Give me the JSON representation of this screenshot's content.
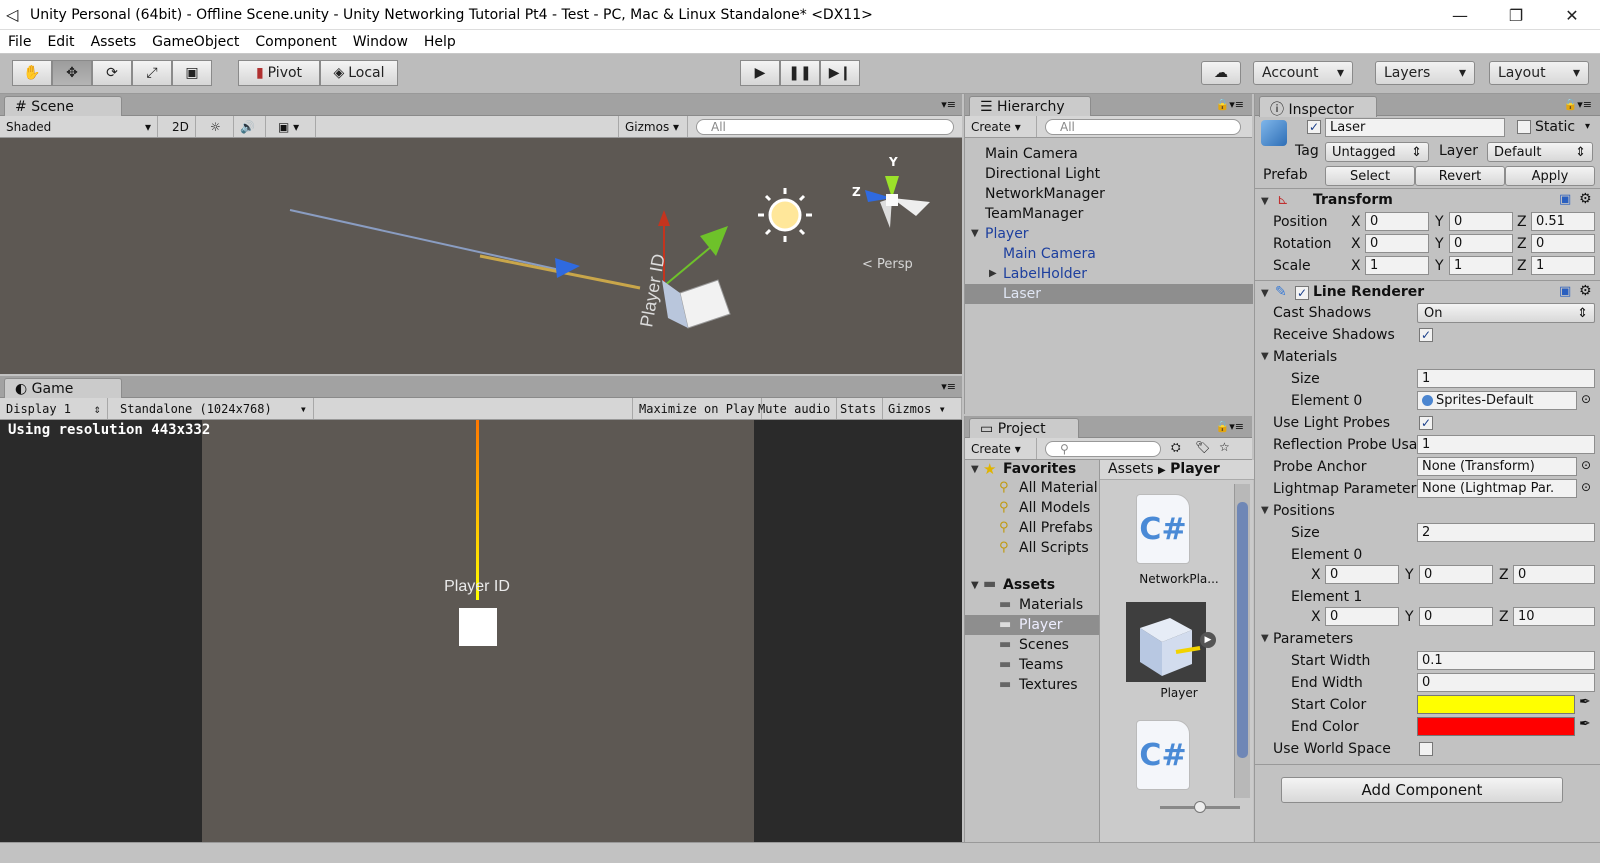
{
  "window": {
    "title": "Unity Personal (64bit) - Offline Scene.unity - Unity Networking Tutorial Pt4 - Test - PC, Mac & Linux Standalone* <DX11>"
  },
  "menu": [
    "File",
    "Edit",
    "Assets",
    "GameObject",
    "Component",
    "Window",
    "Help"
  ],
  "toolbar": {
    "pivot": "Pivot",
    "local": "Local",
    "account": "Account",
    "layers": "Layers",
    "layout": "Layout"
  },
  "scene": {
    "tab": "Scene",
    "shading": "Shaded",
    "mode2d": "2D",
    "gizmos": "Gizmos",
    "search_placeholder": "All",
    "persp": "< Persp",
    "player_label": "Player ID"
  },
  "game": {
    "tab": "Game",
    "display": "Display 1",
    "resolution": "Standalone (1024x768)",
    "maximize": "Maximize on Play",
    "mute": "Mute audio",
    "stats": "Stats",
    "gizmos": "Gizmos",
    "using_resolution": "Using resolution 443x332",
    "player_label": "Player ID"
  },
  "hierarchy": {
    "tab": "Hierarchy",
    "create": "Create",
    "search_placeholder": "All",
    "items": [
      "Main Camera",
      "Directional Light",
      "NetworkManager",
      "TeamManager",
      "Player",
      "Main Camera",
      "LabelHolder",
      "Laser"
    ]
  },
  "project": {
    "tab": "Project",
    "create": "Create",
    "favorites": "Favorites",
    "fav_items": [
      "All Material",
      "All Models",
      "All Prefabs",
      "All Scripts"
    ],
    "assets": "Assets",
    "asset_folders": [
      "Materials",
      "Player",
      "Scenes",
      "Teams",
      "Textures"
    ],
    "breadcrumb_root": "Assets",
    "breadcrumb_current": "Player",
    "files": [
      "NetworkPla...",
      "Player"
    ]
  },
  "inspector": {
    "tab": "Inspector",
    "object_name": "Laser",
    "static": "Static",
    "tag_label": "Tag",
    "tag_value": "Untagged",
    "layer_label": "Layer",
    "layer_value": "Default",
    "prefab_label": "Prefab",
    "select": "Select",
    "revert": "Revert",
    "apply": "Apply",
    "transform": {
      "title": "Transform",
      "position_label": "Position",
      "rotation_label": "Rotation",
      "scale_label": "Scale",
      "position": {
        "x": "0",
        "y": "0",
        "z": "0.51"
      },
      "rotation": {
        "x": "0",
        "y": "0",
        "z": "0"
      },
      "scale": {
        "x": "1",
        "y": "1",
        "z": "1"
      }
    },
    "line_renderer": {
      "title": "Line Renderer",
      "cast_shadows_label": "Cast Shadows",
      "cast_shadows": "On",
      "receive_shadows_label": "Receive Shadows",
      "materials_label": "Materials",
      "size_label": "Size",
      "materials_size": "1",
      "element0_label": "Element 0",
      "element0_value": "Sprites-Default",
      "use_light_probes_label": "Use Light Probes",
      "reflection_probe_label": "Reflection Probe Usa",
      "reflection_probe_value": "1",
      "probe_anchor_label": "Probe Anchor",
      "probe_anchor_value": "None (Transform)",
      "lightmap_label": "Lightmap Parameter",
      "lightmap_value": "None (Lightmap Par.",
      "positions_label": "Positions",
      "positions_size": "2",
      "element1_label": "Element 1",
      "e0": {
        "x": "0",
        "y": "0",
        "z": "0"
      },
      "e1": {
        "x": "0",
        "y": "0",
        "z": "10"
      },
      "parameters_label": "Parameters",
      "start_width_label": "Start Width",
      "start_width": "0.1",
      "end_width_label": "End Width",
      "end_width": "0",
      "start_color_label": "Start Color",
      "start_color": "#ffff00",
      "end_color_label": "End Color",
      "end_color": "#ff0000",
      "use_world_space_label": "Use World Space"
    },
    "add_component": "Add Component"
  },
  "axis_labels": {
    "x": "X",
    "y": "Y",
    "z": "Z"
  }
}
